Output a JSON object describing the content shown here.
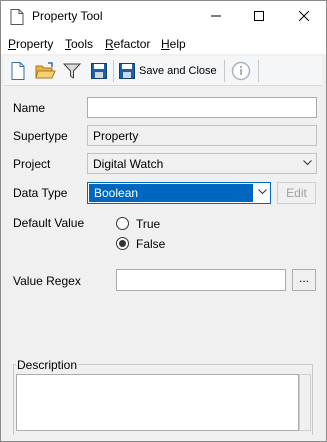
{
  "window": {
    "title": "Property Tool"
  },
  "menu": [
    {
      "accel": "P",
      "rest": "roperty"
    },
    {
      "accel": "T",
      "rest": "ools"
    },
    {
      "accel": "R",
      "rest": "efactor"
    },
    {
      "accel": "H",
      "rest": "elp"
    }
  ],
  "toolbar": {
    "save_close_label": "Save and Close"
  },
  "form": {
    "name_label": "Name",
    "name_value": "",
    "supertype_label": "Supertype",
    "supertype_value": "Property",
    "project_label": "Project",
    "project_value": "Digital Watch",
    "datatype_label": "Data Type",
    "datatype_value": "Boolean",
    "edit_label": "Edit",
    "default_label": "Default Value",
    "opt_true": "True",
    "opt_false": "False",
    "selected_default": "False",
    "regex_label": "Value Regex",
    "regex_value": "",
    "browse_label": "...",
    "description_label": "Description",
    "description_value": ""
  },
  "colors": {
    "accent": "#0067c0",
    "window_bg": "#f0f0f0"
  }
}
